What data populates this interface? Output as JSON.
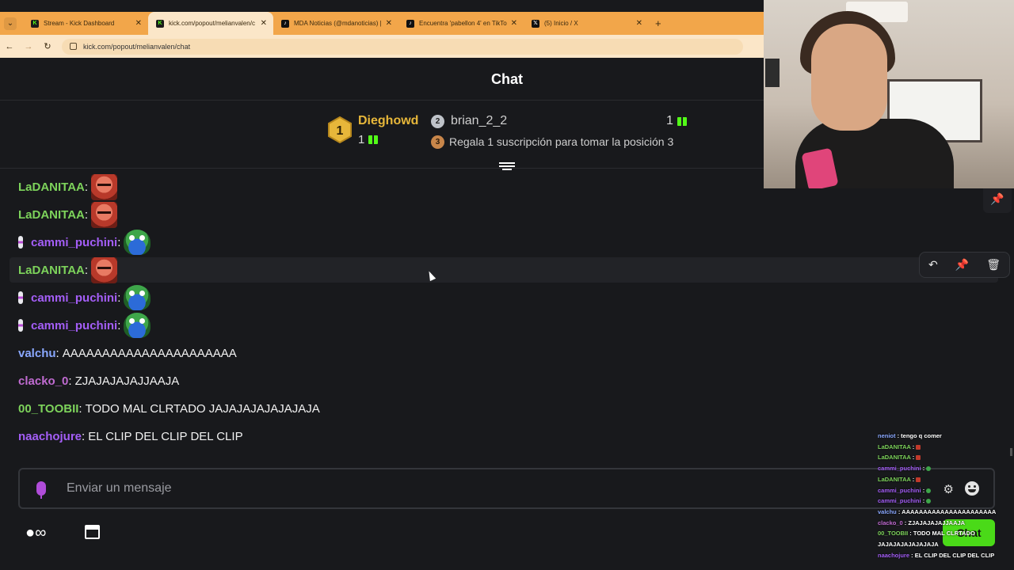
{
  "browser": {
    "tabs": [
      {
        "title": "Stream - Kick Dashboard",
        "icon": "kick-icon",
        "active": false
      },
      {
        "title": "kick.com/popout/melianvalen/c",
        "icon": "kick-icon",
        "active": true
      },
      {
        "title": "MDA Noticias (@mdanoticias) |",
        "icon": "tiktok-icon",
        "active": false
      },
      {
        "title": "Encuentra 'pabellon 4' en TikTo",
        "icon": "tiktok-icon",
        "active": false
      },
      {
        "title": "(5) Inicio / X",
        "icon": "x-icon",
        "active": false
      }
    ],
    "new_tab": "+",
    "url": "kick.com/popout/melianvalen/chat"
  },
  "chat": {
    "title": "Chat",
    "leaderboard": {
      "first": {
        "rank": "1",
        "name": "Dieghowd",
        "count": "1"
      },
      "second": {
        "rank": "2",
        "name": "brian_2_2",
        "count": "1"
      },
      "third": {
        "rank": "3",
        "text": "Regala 1 suscripción para tomar la posición 3"
      }
    },
    "messages": [
      {
        "user": "LaDANITAA",
        "color": "green",
        "badge": false,
        "text": "",
        "emote": "face-emote"
      },
      {
        "user": "LaDANITAA",
        "color": "green",
        "badge": false,
        "text": "",
        "emote": "face-emote"
      },
      {
        "user": "cammi_puchini",
        "color": "purple",
        "badge": true,
        "text": "",
        "emote": "frog-emote"
      },
      {
        "user": "LaDANITAA",
        "color": "green",
        "badge": false,
        "text": "",
        "emote": "face-emote",
        "highlighted": true
      },
      {
        "user": "cammi_puchini",
        "color": "purple",
        "badge": true,
        "text": "",
        "emote": "frog-emote"
      },
      {
        "user": "cammi_puchini",
        "color": "purple",
        "badge": true,
        "text": "",
        "emote": "frog-emote"
      },
      {
        "user": "valchu",
        "color": "blue",
        "badge": false,
        "text": "AAAAAAAAAAAAAAAAAAAAAA"
      },
      {
        "user": "clacko_0",
        "color": "pink",
        "badge": false,
        "text": "ZJAJAJAJAJJAAJA"
      },
      {
        "user": "00_TOOBII",
        "color": "green",
        "badge": false,
        "text": "TODO MAL CLRTADO JAJAJAJAJAJAJAJA"
      },
      {
        "user": "naachojure",
        "color": "purple",
        "badge": false,
        "text": "EL CLIP DEL CLIP DEL CLIP"
      }
    ],
    "composer": {
      "placeholder": "Enviar un mensaje",
      "send_label": "Chat"
    },
    "bottom": {
      "kicks_label": "∞"
    },
    "colon": ":"
  },
  "overlay": {
    "lines": [
      {
        "user": "neniot",
        "text": "tengo q comer",
        "color": "b"
      },
      {
        "user": "LaDANITAA",
        "text": "",
        "color": "",
        "emote": true
      },
      {
        "user": "LaDANITAA",
        "text": "",
        "color": "",
        "emote": true
      },
      {
        "user": "cammi_puchini",
        "text": "",
        "color": "p",
        "emote": true,
        "frog": true
      },
      {
        "user": "LaDANITAA",
        "text": "",
        "color": "",
        "emote": true
      },
      {
        "user": "cammi_puchini",
        "text": "",
        "color": "p",
        "emote": true,
        "frog": true
      },
      {
        "user": "cammi_puchini",
        "text": "",
        "color": "p",
        "emote": true,
        "frog": true
      },
      {
        "user": "valchu",
        "text": "AAAAAAAAAAAAAAAAAAAAAA",
        "color": "b"
      },
      {
        "user": "clacko_0",
        "text": "ZJAJAJAJAJJAAJA",
        "color": "pk"
      },
      {
        "user": "00_TOOBII",
        "text": "TODO MAL CLRTADO",
        "color": ""
      },
      {
        "user": "",
        "text": "JAJAJAJAJAJAJAJA",
        "color": ""
      },
      {
        "user": "naachojure",
        "text": "EL CLIP DEL CLIP DEL CLIP",
        "color": "p"
      }
    ]
  },
  "colors": {
    "kick_green": "#53fc18",
    "gold": "#e7b73a",
    "bg": "#18191c"
  }
}
